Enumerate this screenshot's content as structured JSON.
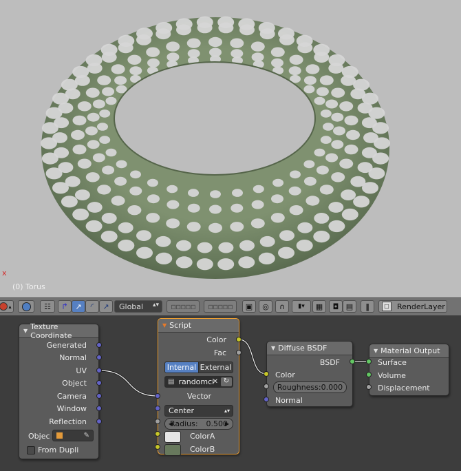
{
  "viewport": {
    "object_label": "(0) Torus",
    "axis_marker": "x",
    "colors": {
      "background": "#bdbdbd",
      "torus_green": "#6b7d5d",
      "scallop": "#d6d6d6"
    }
  },
  "header": {
    "transform_orientation": "Global",
    "render_layer": "RenderLayer"
  },
  "nodes": {
    "texture_coordinate": {
      "title": "Texture Coordinate",
      "outputs": [
        "Generated",
        "Normal",
        "UV",
        "Object",
        "Camera",
        "Window",
        "Reflection"
      ],
      "object_label": "Objec",
      "from_dupli_label": "From Dupli"
    },
    "script": {
      "title": "Script",
      "outputs": [
        "Color",
        "Fac"
      ],
      "mode_internal": "Internal",
      "mode_external": "External",
      "script_name": "randomci",
      "vector_label": "Vector",
      "center_option": "Center",
      "radius_label": "Radius:",
      "radius_value": "0.500",
      "colora_label": "ColorA",
      "colorb_label": "ColorB",
      "colora_value": "#e6e6e6",
      "colorb_value": "#68795d"
    },
    "diffuse_bsdf": {
      "title": "Diffuse BSDF",
      "output": "BSDF",
      "color_label": "Color",
      "roughness_label": "Roughness:",
      "roughness_value": "0.000",
      "normal_label": "Normal"
    },
    "material_output": {
      "title": "Material Output",
      "inputs": [
        "Surface",
        "Volume",
        "Displacement"
      ]
    }
  }
}
